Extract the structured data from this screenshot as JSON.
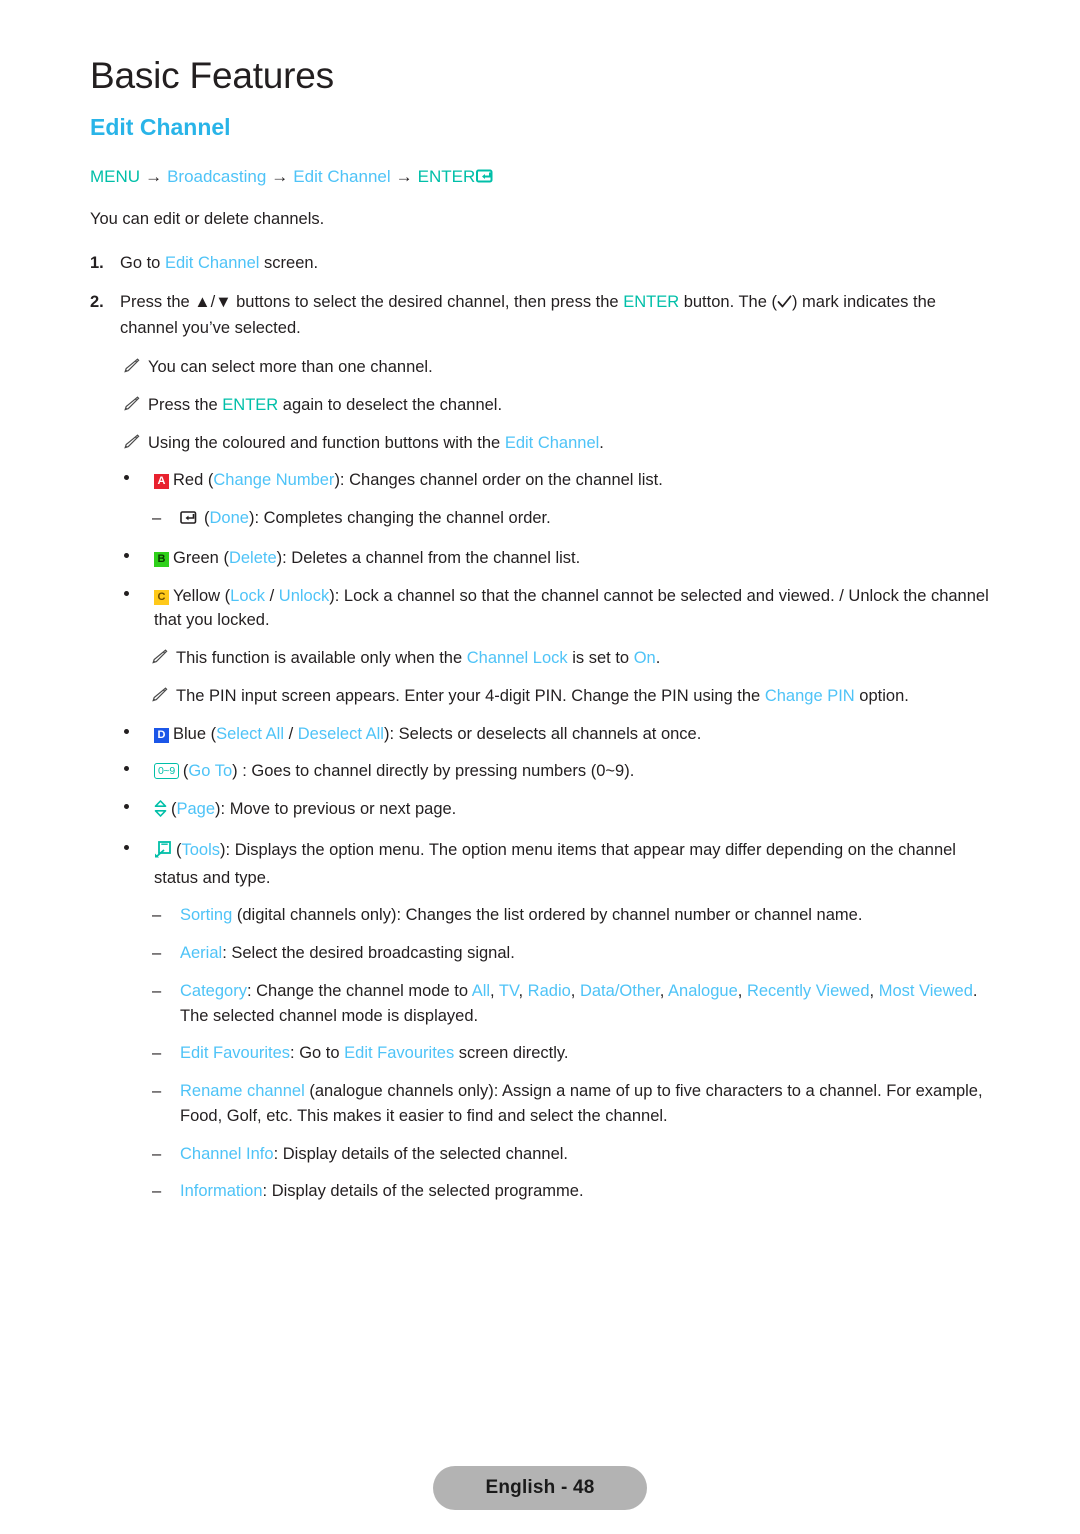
{
  "header": {
    "page_title": "Basic Features",
    "section_title": "Edit Channel"
  },
  "breadcrumb": {
    "menu": "MENU",
    "arrow": "→",
    "broadcasting": "Broadcasting",
    "edit_channel": "Edit Channel",
    "enter": "ENTER",
    "enter_icon": "enter-return-icon"
  },
  "intro": "You can edit or delete channels.",
  "steps": [
    {
      "number": "1.",
      "pre": "Go to ",
      "link": "Edit Channel",
      "post": " screen."
    },
    {
      "number": "2.",
      "pre": "Press the ▲/▼ buttons to select the desired channel, then press the ",
      "link": "ENTER",
      "mid": " button. The (",
      "check_icon": "check-mark-icon",
      "post": ") mark indicates the channel you’ve selected."
    }
  ],
  "notes_top": [
    {
      "icon": "pencil-note-icon",
      "text": "You can select more than one channel."
    },
    {
      "icon": "pencil-note-icon",
      "pre": "Press the ",
      "link": "ENTER",
      "post": " again to deselect the channel."
    },
    {
      "icon": "pencil-note-icon",
      "pre": "Using the coloured and function buttons with the ",
      "link": "Edit Channel",
      "post": "."
    }
  ],
  "bullets": [
    {
      "badge": {
        "kind": "key",
        "letter": "A",
        "color": "#e8212e",
        "name": "red-key-badge"
      },
      "pre": "Red (",
      "link": "Change Number",
      "post": "): Changes channel order on the channel list."
    },
    {
      "badge": {
        "kind": "key",
        "letter": "B",
        "color": "#2fd01a",
        "name": "green-key-badge"
      },
      "pre": "Green (",
      "link": "Delete",
      "post": "): Deletes a channel from the channel list."
    },
    {
      "badge": {
        "kind": "key",
        "letter": "C",
        "color": "#ffc91a",
        "name": "yellow-key-badge"
      },
      "pre": "Yellow (",
      "link": "Lock",
      "sep": " / ",
      "link2": "Unlock",
      "post": "): Lock a channel so that the channel cannot be selected and viewed. / Unlock the channel that you locked."
    },
    {
      "badge": {
        "kind": "key",
        "letter": "D",
        "color": "#1b56e8",
        "name": "blue-key-badge"
      },
      "pre": "Blue (",
      "link": "Select All",
      "sep": " / ",
      "link2": "Deselect All",
      "post": "): Selects or deselects all channels at once."
    },
    {
      "badge": {
        "kind": "numeric",
        "letter": "0~9",
        "name": "numeric-keys-badge"
      },
      "pre": "(",
      "link": "Go To",
      "post": ") : Goes to channel directly by pressing numbers (0~9)."
    },
    {
      "badge": {
        "kind": "page",
        "name": "page-updown-icon"
      },
      "pre": "(",
      "link": "Page",
      "post": "): Move to previous or next page."
    },
    {
      "badge": {
        "kind": "tools",
        "name": "tools-icon"
      },
      "pre": "(",
      "link": "Tools",
      "post": "): Displays the option menu. The option menu items that appear may differ depending on the channel status and type."
    }
  ],
  "sub_bullet_done": {
    "dash": "–",
    "icon": "enter-return-outline-icon",
    "pre": "(",
    "link": "Done",
    "post": "): Completes changing the channel order."
  },
  "notes_lock": [
    {
      "icon": "pencil-note-icon",
      "pre": "This function is available only when the ",
      "link": "Channel Lock",
      "mid": " is set to ",
      "link2": "On",
      "post": "."
    },
    {
      "icon": "pencil-note-icon",
      "pre": "The PIN input screen appears. Enter your 4-digit PIN. Change the PIN using the ",
      "link": "Change PIN",
      "post": " option."
    }
  ],
  "tools_options": [
    {
      "dash": "–",
      "link": "Sorting",
      "post": " (digital channels only): Changes the list ordered by channel number or channel name."
    },
    {
      "dash": "–",
      "link": "Aerial",
      "post": ": Select the desired broadcasting signal."
    },
    {
      "dash": "–",
      "link": "Category",
      "mid": ": Change the channel mode to ",
      "modes": [
        "All",
        "TV",
        "Radio",
        "Data/Other",
        "Analogue",
        "Recently Viewed",
        "Most Viewed"
      ],
      "post": ". The selected channel mode is displayed."
    },
    {
      "dash": "–",
      "link": "Edit Favourites",
      "mid": ": Go to ",
      "link2": "Edit Favourites",
      "post": " screen directly."
    },
    {
      "dash": "–",
      "link": "Rename channel",
      "post": " (analogue channels only): Assign a name of up to five characters to a channel. For example, Food, Golf, etc. This makes it easier to find and select the channel."
    },
    {
      "dash": "–",
      "link": "Channel Info",
      "post": ": Display details of the selected channel."
    },
    {
      "dash": "–",
      "link": "Information",
      "post": ": Display details of the selected programme."
    }
  ],
  "footer": {
    "label": "English - 48"
  },
  "colors": {
    "link_blue": "#4ec3f7",
    "teal": "#00bfa8",
    "body": "#231f20",
    "footer_pill": "#b3b3b3"
  }
}
